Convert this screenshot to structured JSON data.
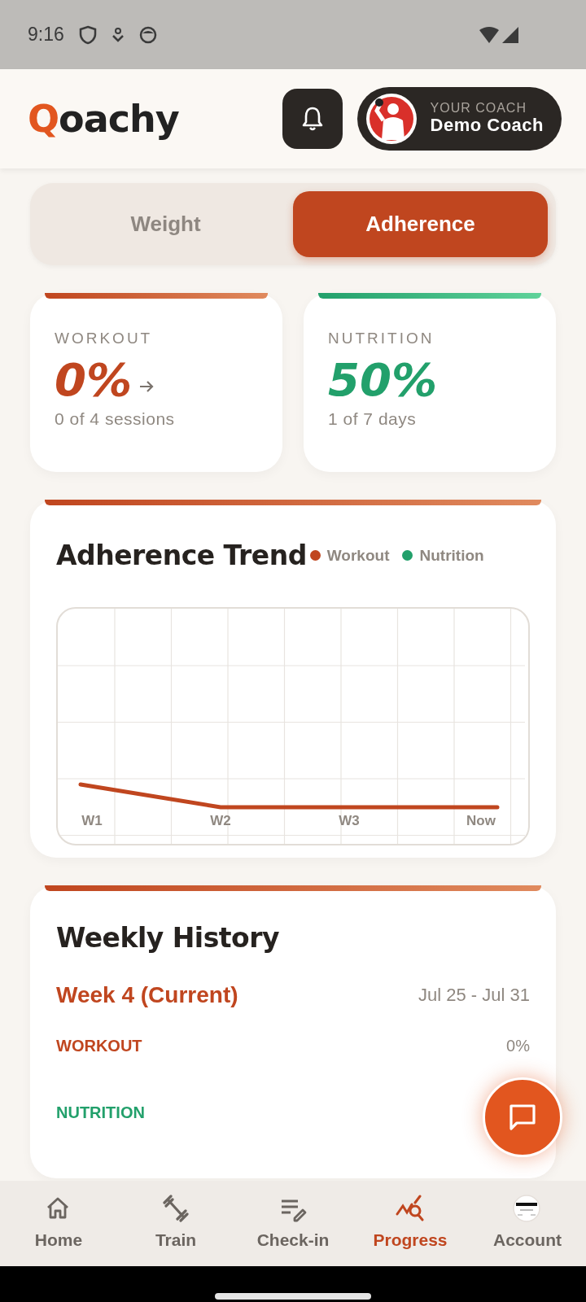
{
  "status_bar": {
    "time": "9:16"
  },
  "header": {
    "logo_initial": "Q",
    "logo_rest": "oachy",
    "coach_label": "YOUR COACH",
    "coach_name": "Demo Coach"
  },
  "tabs": [
    {
      "label": "Weight",
      "selected": false
    },
    {
      "label": "Adherence",
      "selected": true
    }
  ],
  "stats": [
    {
      "kind": "workout",
      "label": "WORKOUT",
      "value": "0%",
      "detail": "0 of 4 sessions",
      "arrow": true
    },
    {
      "kind": "nutrition",
      "label": "NUTRITION",
      "value": "50%",
      "detail": "1 of 7 days",
      "arrow": false
    }
  ],
  "trend": {
    "title": "Adherence Trend",
    "legend": [
      {
        "label": "Workout",
        "color": "#c0461f"
      },
      {
        "label": "Nutrition",
        "color": "#22a06b"
      }
    ],
    "x_labels": [
      "W1",
      "W2",
      "W3",
      "Now"
    ]
  },
  "history": {
    "title": "Weekly History",
    "weeks": [
      {
        "title": "Week 4 (Current)",
        "dates": "Jul 25 - Jul 31",
        "rows": [
          {
            "kind": "workout",
            "label": "WORKOUT",
            "value": "0%"
          },
          {
            "kind": "nutrition",
            "label": "NUTRITION"
          }
        ]
      }
    ]
  },
  "nav": [
    {
      "label": "Home",
      "selected": false
    },
    {
      "label": "Train",
      "selected": false
    },
    {
      "label": "Check-in",
      "selected": false
    },
    {
      "label": "Progress",
      "selected": true
    },
    {
      "label": "Account",
      "selected": false
    }
  ]
}
